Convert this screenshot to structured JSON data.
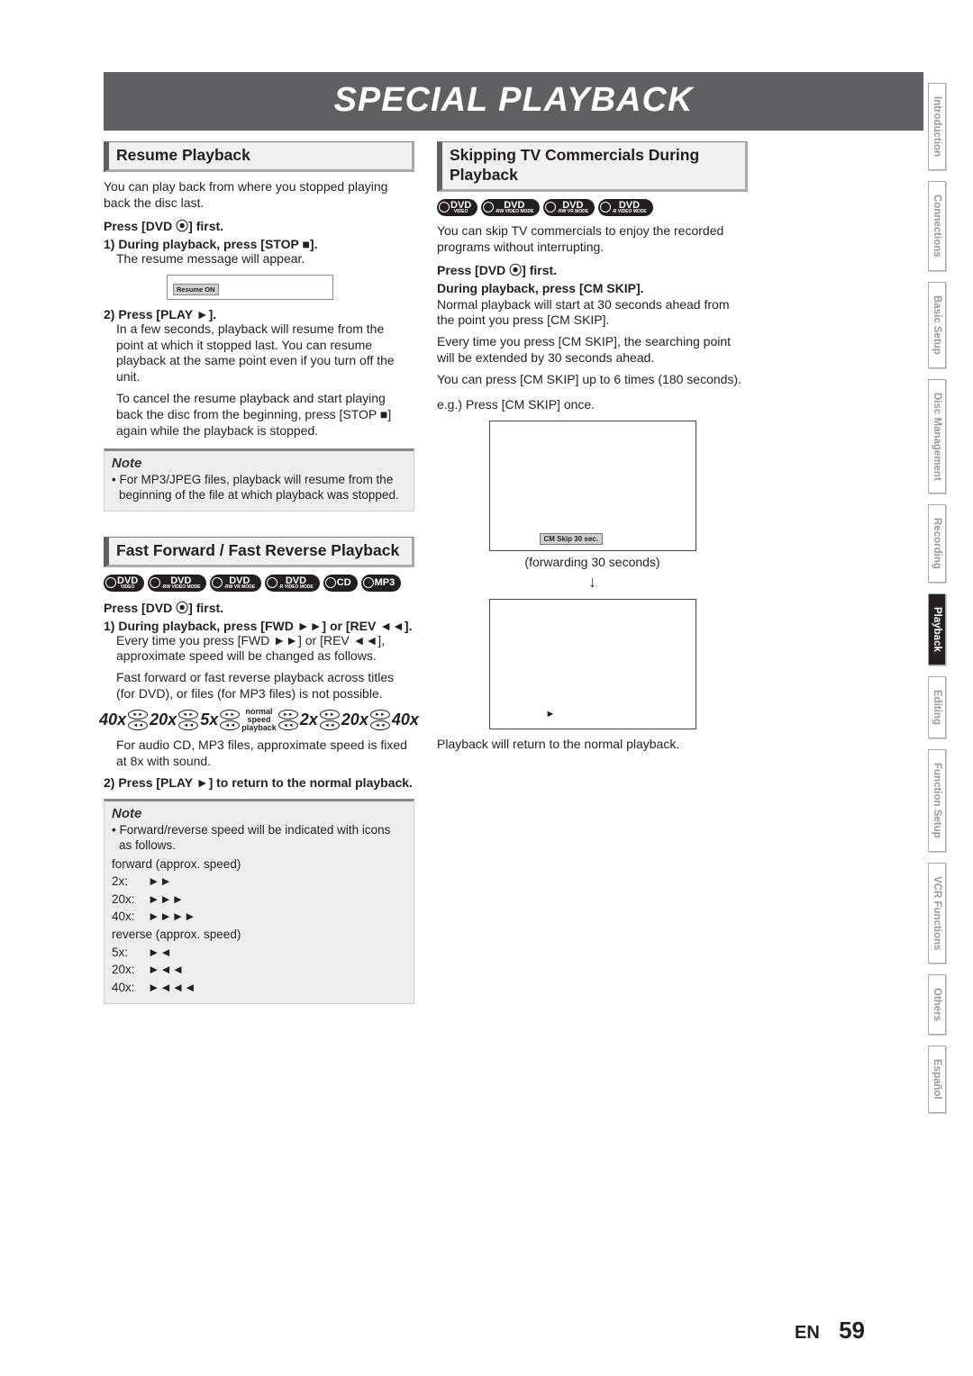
{
  "hero": "SPECIAL PLAYBACK",
  "left": {
    "sec1": {
      "title": "Resume Playback",
      "p1": "You can play back from where you stopped playing back the disc last.",
      "press": "Press [DVD ⦿] first.",
      "s1a": "1) During playback, press [STOP ■].",
      "s1b": "The resume message will appear.",
      "resume_tag": "Resume ON",
      "s2a": "2) Press [PLAY ►].",
      "s2b": "In a few seconds, playback will resume from the point at which it stopped last. You can resume playback at the same point even if you turn off the unit.",
      "s2c": "To cancel the resume playback and start playing back the disc from the beginning, press [STOP ■] again while the playback is stopped.",
      "note_h": "Note",
      "note1": "For MP3/JPEG files, playback will resume from the beginning of the file at which playback was stopped."
    },
    "sec2": {
      "title": "Fast Forward / Fast Reverse Playback",
      "badges": [
        "DVD",
        "DVD",
        "DVD",
        "DVD",
        "CD",
        "MP3"
      ],
      "badge_subs": [
        "VIDEO",
        "-RW VIDEO MODE",
        "-RW VR MODE",
        "-R VIDEO MODE",
        "",
        ""
      ],
      "press": "Press [DVD ⦿] first.",
      "s1a": "1) During playback, press [FWD ►►] or [REV ◄◄].",
      "s1b": "Every time you press [FWD ►►] or [REV ◄◄], approximate speed will be changed as follows.",
      "s1c": "Fast forward or fast reverse playback across titles (for DVD), or files (for MP3 files) is not possible.",
      "speeds_left": [
        "40x",
        "20x",
        "5x"
      ],
      "center": "normal speed playback",
      "speeds_right": [
        "2x",
        "20x",
        "40x"
      ],
      "s1d": "For audio CD, MP3 files, approximate speed is fixed at 8x with sound.",
      "s2a": "2) Press [PLAY ►] to return to the normal playback.",
      "note_h": "Note",
      "note1": "Forward/reverse speed will be indicated with icons as follows.",
      "fwd_h": "forward (approx. speed)",
      "fwd": [
        {
          "l": "2x:",
          "g": "►►"
        },
        {
          "l": "20x:",
          "g": "►►►"
        },
        {
          "l": "40x:",
          "g": "►►►►"
        }
      ],
      "rev_h": "reverse (approx. speed)",
      "rev": [
        {
          "l": "5x:",
          "g": "►◄"
        },
        {
          "l": "20x:",
          "g": "►◄◄"
        },
        {
          "l": "40x:",
          "g": "►◄◄◄"
        }
      ]
    }
  },
  "right": {
    "title": "Skipping TV Commercials During Playback",
    "badges": [
      "DVD",
      "DVD",
      "DVD",
      "DVD"
    ],
    "badge_subs": [
      "VIDEO",
      "-RW VIDEO MODE",
      "-RW VR MODE",
      "-R VIDEO MODE"
    ],
    "p1": "You can skip TV commercials to enjoy the recorded programs without interrupting.",
    "press": "Press [DVD ⦿] first.",
    "s1a": "During playback, press [CM SKIP].",
    "p2": "Normal playback will start at 30 seconds ahead from the point you press [CM SKIP].",
    "p3": "Every time you press [CM SKIP], the searching point will be extended by 30 seconds ahead.",
    "p4": "You can press [CM SKIP] up to 6 times (180 seconds).",
    "eg": "e.g.) Press [CM SKIP] once.",
    "box1_tag": "CM Skip 30 sec.",
    "cap1": "(forwarding 30 seconds)",
    "p5": "Playback will return to the normal playback."
  },
  "tabs": [
    "Introduction",
    "Connections",
    "Basic Setup",
    "Disc Management",
    "Recording",
    "Playback",
    "Editing",
    "Function Setup",
    "VCR Functions",
    "Others",
    "Español"
  ],
  "active_tab": "Playback",
  "footer": {
    "lang": "EN",
    "page": "59"
  }
}
